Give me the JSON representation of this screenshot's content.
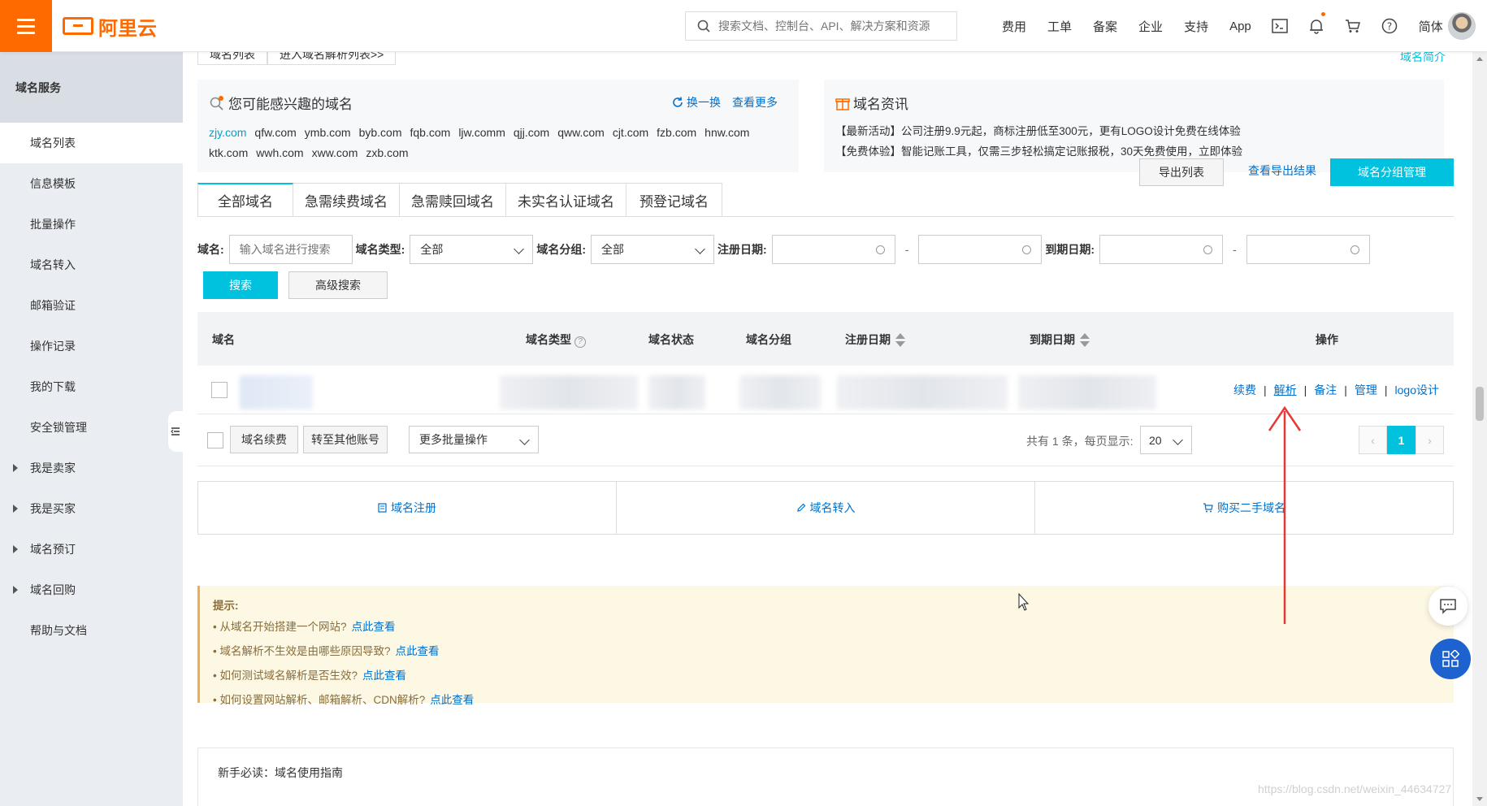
{
  "brand": {
    "name": "阿里云"
  },
  "search": {
    "placeholder": "搜索文档、控制台、API、解决方案和资源"
  },
  "top_nav": {
    "items": [
      "费用",
      "工单",
      "备案",
      "企业",
      "支持",
      "App"
    ],
    "lang": "简体"
  },
  "sidebar": {
    "header": "域名服务",
    "items": [
      {
        "label": "域名列表"
      },
      {
        "label": "信息模板"
      },
      {
        "label": "批量操作"
      },
      {
        "label": "域名转入"
      },
      {
        "label": "邮箱验证"
      },
      {
        "label": "操作记录"
      },
      {
        "label": "我的下载"
      },
      {
        "label": "安全锁管理"
      },
      {
        "label": "我是卖家"
      },
      {
        "label": "我是买家"
      },
      {
        "label": "域名预订"
      },
      {
        "label": "域名回购"
      },
      {
        "label": "帮助与文档"
      }
    ]
  },
  "crumb": {
    "tab1": "域名列表",
    "tab2": "进入域名解析列表>>",
    "intro": "域名简介"
  },
  "interest": {
    "title": "您可能感兴趣的域名",
    "refresh": "换一换",
    "more": "查看更多",
    "domains": [
      "zjy.com",
      "qfw.com",
      "ymb.com",
      "byb.com",
      "fqb.com",
      "ljw.comm",
      "qjj.com",
      "qww.com",
      "cjt.com",
      "fzb.com",
      "hnw.com",
      "ktk.com",
      "wwh.com",
      "xww.com",
      "zxb.com"
    ]
  },
  "news": {
    "title": "域名资讯",
    "line1": "【最新活动】公司注册9.9元起，商标注册低至300元，更有LOGO设计免费在线体验",
    "line2": "【免费体验】智能记账工具，仅需三步轻松搞定记账报税，30天免费使用，立即体验"
  },
  "tabs": [
    "全部域名",
    "急需续费域名",
    "急需赎回域名",
    "未实名认证域名",
    "预登记域名"
  ],
  "actions": {
    "export": "导出列表",
    "export_result": "查看导出结果",
    "group_manage": "域名分组管理"
  },
  "filters": {
    "domain_label": "域名:",
    "domain_placeholder": "输入域名进行搜索",
    "type_label": "域名类型:",
    "type_value": "全部",
    "group_label": "域名分组:",
    "group_value": "全部",
    "reg_label": "注册日期:",
    "exp_label": "到期日期:",
    "dash": "-",
    "search": "搜索",
    "advanced": "高级搜索"
  },
  "table": {
    "headers": {
      "domain": "域名",
      "type": "域名类型",
      "status": "域名状态",
      "group": "域名分组",
      "reg": "注册日期",
      "exp": "到期日期",
      "ops": "操作"
    },
    "row_ops": [
      "续费",
      "解析",
      "备注",
      "管理",
      "logo设计"
    ],
    "footer": {
      "renew": "域名续费",
      "transfer": "转至其他账号",
      "batch": "更多批量操作",
      "summary": "共有 1 条，每页显示:",
      "page_size": "20",
      "current_page": "1",
      "prev": "‹",
      "next": "›"
    }
  },
  "quick_links": [
    "域名注册",
    "域名转入",
    "购买二手域名"
  ],
  "tips": {
    "title": "提示:",
    "items": [
      {
        "text": "• 从域名开始搭建一个网站?",
        "link": "点此查看"
      },
      {
        "text": "• 域名解析不生效是由哪些原因导致?",
        "link": "点此查看"
      },
      {
        "text": "• 如何测试域名解析是否生效?",
        "link": "点此查看"
      },
      {
        "text": "• 如何设置网站解析、邮箱解析、CDN解析?",
        "link": "点此查看"
      }
    ]
  },
  "guide": {
    "text": "新手必读：域名使用指南"
  },
  "watermark": "https://blog.csdn.net/weixin_44634727",
  "colors": {
    "accent": "#00c1de",
    "brand": "#ff6a00",
    "link": "#0070cc",
    "annotation": "#e53935"
  }
}
